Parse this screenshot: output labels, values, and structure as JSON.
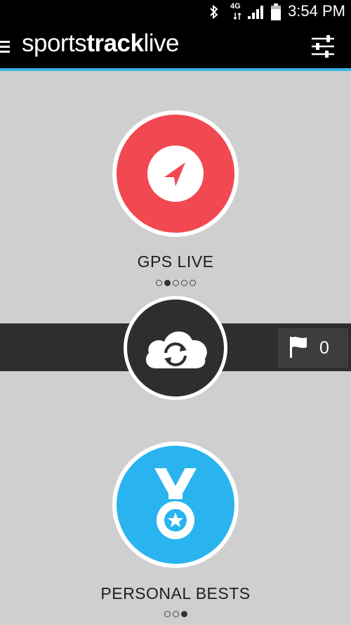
{
  "status_bar": {
    "network": "4G",
    "time": "3:54 PM",
    "icons": [
      "bluetooth-icon",
      "network-4g-icon",
      "signal-icon",
      "battery-icon"
    ]
  },
  "app_bar": {
    "title_light_1": "sports",
    "title_bold": "track",
    "title_light_2": "live",
    "accent_color": "#3bb6e6",
    "icons": [
      "menu-icon",
      "settings-sliders-icon"
    ]
  },
  "gps_live": {
    "label": "GPS LIVE",
    "icon": "navigation-arrow-icon",
    "color": "#f24851",
    "pager": {
      "count": 5,
      "active": 1
    }
  },
  "sync": {
    "icon": "cloud-sync-icon",
    "flag_icon": "flag-icon",
    "flag_count": "0"
  },
  "personal_bests": {
    "label": "PERSONAL BESTS",
    "icon": "medal-icon",
    "color": "#29b4ef",
    "pager": {
      "count": 3,
      "active": 2
    }
  }
}
